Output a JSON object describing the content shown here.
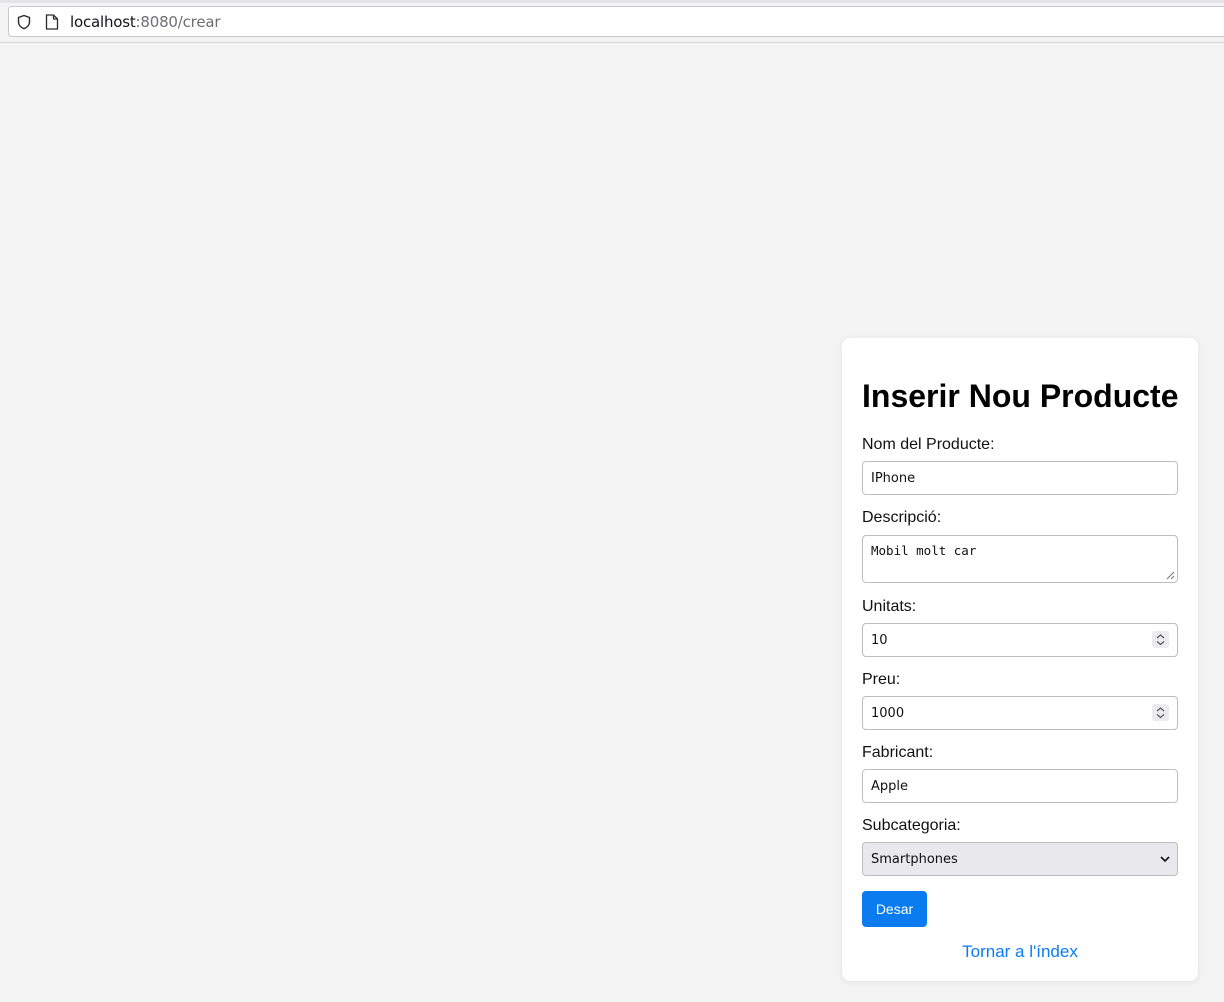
{
  "browser": {
    "url_host": "localhost",
    "url_rest": ":8080/crear",
    "icons": [
      "shield-icon",
      "page-icon"
    ]
  },
  "form": {
    "title": "Inserir Nou Producte",
    "name_label": "Nom del Producte:",
    "name_value": "IPhone",
    "description_label": "Descripció:",
    "description_value": "Mobil molt car",
    "units_label": "Unitats:",
    "units_value": "10",
    "price_label": "Preu:",
    "price_value": "1000",
    "manufacturer_label": "Fabricant:",
    "manufacturer_value": "Apple",
    "subcategory_label": "Subcategoria:",
    "subcategory_value": "Smartphones",
    "save_label": "Desar",
    "back_link": "Tornar a l'índex"
  },
  "colors": {
    "page_bg": "#f3f3f3",
    "card_bg": "#ffffff",
    "accent": "#0a7cf0"
  }
}
